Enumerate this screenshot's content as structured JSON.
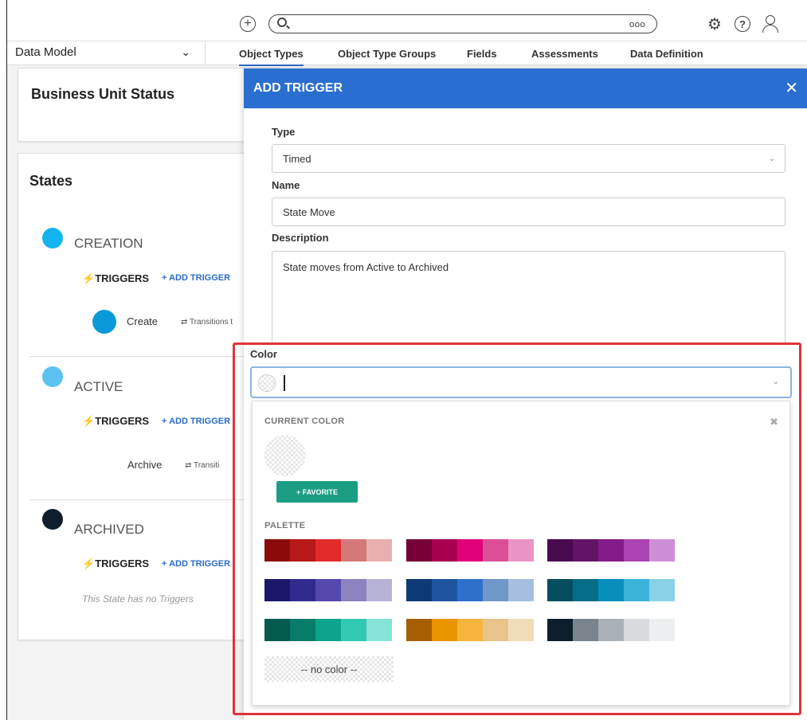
{
  "topbar": {
    "add_icon": "plus-circle-icon",
    "search_placeholder": "",
    "search_more": "ooo",
    "icons": [
      "gear-icon",
      "help-icon",
      "user-icon"
    ]
  },
  "nav": {
    "select_value": "Data Model",
    "tabs": [
      "Object Types",
      "Object Type Groups",
      "Fields",
      "Assessments",
      "Data Definition"
    ],
    "active_tab": "Object Types"
  },
  "left": {
    "card_title": "Business Unit Status",
    "states_title": "States",
    "states": [
      {
        "name": "CREATION",
        "color": "#13b4f0",
        "triggers_label": "TRIGGERS",
        "add_trigger": "+ ADD TRIGGER",
        "trigger": {
          "name": "Create",
          "color": "#0b9ad9",
          "transition": "⇄ Transitions t"
        }
      },
      {
        "name": "ACTIVE",
        "color": "#5cc2f2",
        "triggers_label": "TRIGGERS",
        "add_trigger": "+ ADD TRIGGER",
        "trigger": {
          "name": "Archive",
          "transition": "⇄ Transiti"
        }
      },
      {
        "name": "ARCHIVED",
        "color": "#0f1e2c",
        "triggers_label": "TRIGGERS",
        "add_trigger": "+ ADD TRIGGER",
        "no_triggers": "This State has no Triggers"
      }
    ]
  },
  "modal": {
    "title": "ADD TRIGGER",
    "close": "✕",
    "type_label": "Type",
    "type_value": "Timed",
    "name_label": "Name",
    "name_value": "State Move",
    "description_label": "Description",
    "description_value": "State moves from Active to Archived",
    "color_label": "Color",
    "picker": {
      "current_color_title": "CURRENT COLOR",
      "close": "✖",
      "favorite_label": "+ FAVORITE",
      "palette_title": "PALETTE",
      "no_color_label": "-- no color --",
      "palette_groups": [
        [
          "#8b0b0b",
          "#b71818",
          "#e32b2b",
          "#d57878",
          "#e6b0b0"
        ],
        [
          "#760035",
          "#a8004f",
          "#e0007a",
          "#dc4f98",
          "#e995c4"
        ],
        [
          "#4a0a4f",
          "#641466",
          "#831c88",
          "#aa44b2",
          "#cc8fd5"
        ],
        [
          "#1c1869",
          "#322b8f",
          "#5448ad",
          "#8c83bf",
          "#b7b3d6"
        ],
        [
          "#0e3a75",
          "#1e55a0",
          "#2e70cc",
          "#6f97c8",
          "#a6bedf"
        ],
        [
          "#054d5f",
          "#066c87",
          "#078fbb",
          "#3bb3d9",
          "#8ad1e6"
        ],
        [
          "#045b4e",
          "#077c6a",
          "#0ca48c",
          "#32c9b2",
          "#86e3d6"
        ],
        [
          "#a55f00",
          "#ea9400",
          "#f5b43c",
          "#e8c38a",
          "#f0dcb9"
        ],
        [
          "#0d1f2f",
          "#7a848c",
          "#a9b0b6",
          "#d7dbde",
          "#eceeef"
        ]
      ]
    }
  }
}
